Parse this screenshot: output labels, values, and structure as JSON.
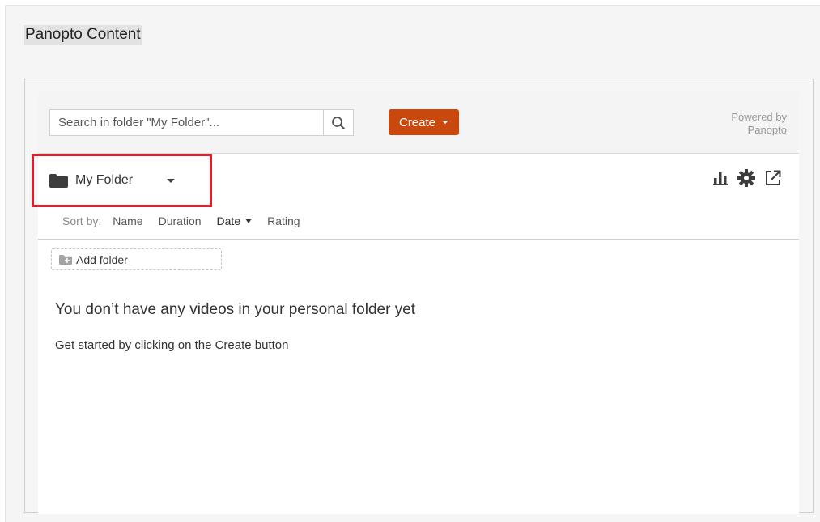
{
  "page": {
    "title": "Panopto Content"
  },
  "toolbar": {
    "search_placeholder": "Search in folder \"My Folder\"...",
    "search_icon": "search-icon",
    "create_label": "Create",
    "powered_line1": "Powered by",
    "powered_line2": "Panopto"
  },
  "folder": {
    "name": "My Folder",
    "icon": "folder-icon",
    "actions": [
      "bar-chart-icon",
      "gear-icon",
      "external-link-icon"
    ]
  },
  "sort": {
    "label": "Sort by:",
    "options": [
      "Name",
      "Duration",
      "Date",
      "Rating"
    ],
    "active": "Date"
  },
  "add_folder": {
    "label": "Add folder"
  },
  "empty_state": {
    "title": "You don’t have any videos in your personal folder yet",
    "subtitle": "Get started by clicking on the Create button"
  },
  "colors": {
    "accent": "#c9480e",
    "highlight": "#e01e2b"
  }
}
